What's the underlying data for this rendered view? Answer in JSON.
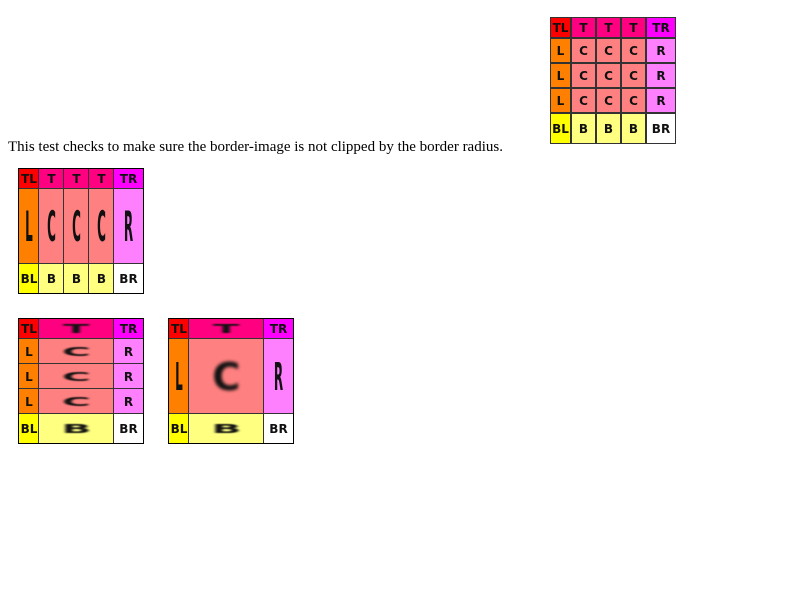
{
  "description": "This test checks to make sure the border-image is not clipped by the border radius.",
  "labels": {
    "top_left": "TL",
    "top": "T",
    "top_right": "TR",
    "left": "L",
    "center": "C",
    "right": "R",
    "bottom_left": "BL",
    "bottom": "B",
    "bottom_right": "BR"
  },
  "colors": {
    "top_left": "#ff0000",
    "top": "#ff0080",
    "top_right": "#ff00ff",
    "left": "#ff8000",
    "center": "#ff8080",
    "right": "#ff80ff",
    "bottom_left": "#ffff00",
    "bottom": "#ffff80",
    "bottom_right": "#ffffff",
    "border": "#000000"
  },
  "boxes": [
    {
      "name": "reference-border-image",
      "border_image_repeat": "source"
    },
    {
      "name": "border-image-stretch-vertical",
      "border_image_repeat": "round horizontal, stretch vertical"
    },
    {
      "name": "border-image-stretch-horizontal",
      "border_image_repeat": "stretch horizontal, round vertical"
    },
    {
      "name": "border-image-stretch-both",
      "border_image_repeat": "stretch"
    }
  ]
}
